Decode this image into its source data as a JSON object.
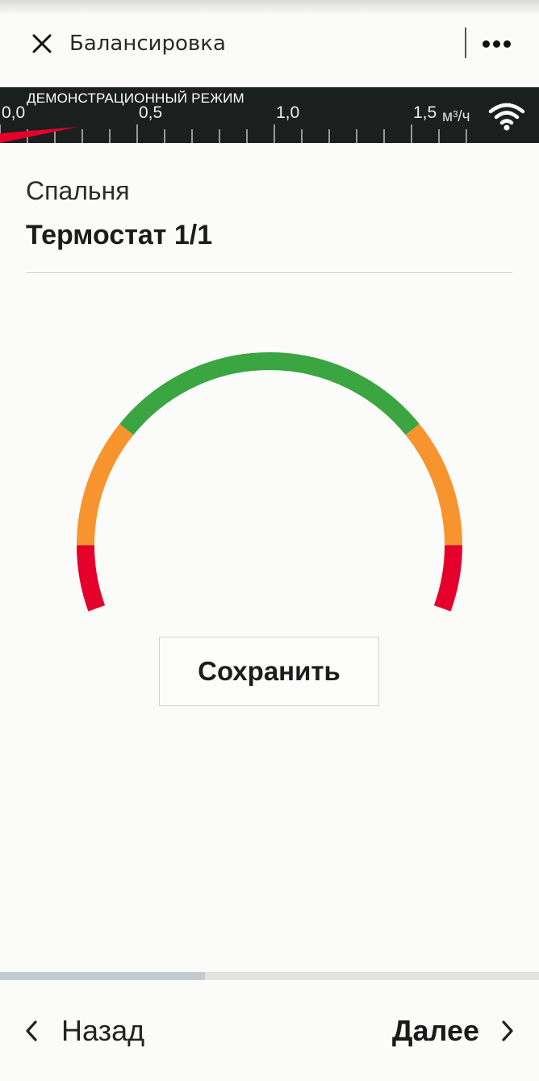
{
  "header": {
    "title": "Балансировка",
    "close_icon": "close-icon",
    "more_icon": "more-dots-icon"
  },
  "flowbar": {
    "demo_label": "ДЕМОНСТРАЦИОННЫЙ РЕЖИМ",
    "ticks": [
      "0,0",
      "0,5",
      "1,0",
      "1,5"
    ],
    "unit": "м³/ч",
    "scale": [
      0,
      1.5
    ],
    "current_flow_fraction": 0.1,
    "colors": {
      "background": "#1b1f1d",
      "indicator": "#e4002b"
    },
    "wifi_icon": "wifi-icon"
  },
  "room": {
    "name": "Спальня",
    "device": "Термостат 1/1"
  },
  "gauge": {
    "segments": [
      {
        "color": "#e4002b",
        "name": "low-red"
      },
      {
        "color": "#f7942d",
        "name": "low-orange"
      },
      {
        "color": "#3aa541",
        "name": "green"
      },
      {
        "color": "#f7942d",
        "name": "high-orange"
      },
      {
        "color": "#e4002b",
        "name": "high-red"
      }
    ]
  },
  "actions": {
    "save_label": "Сохранить"
  },
  "progress": {
    "value": 0.38
  },
  "footer": {
    "back_label": "Назад",
    "next_label": "Далее",
    "back_icon": "chevron-left-icon",
    "next_icon": "chevron-right-icon"
  }
}
